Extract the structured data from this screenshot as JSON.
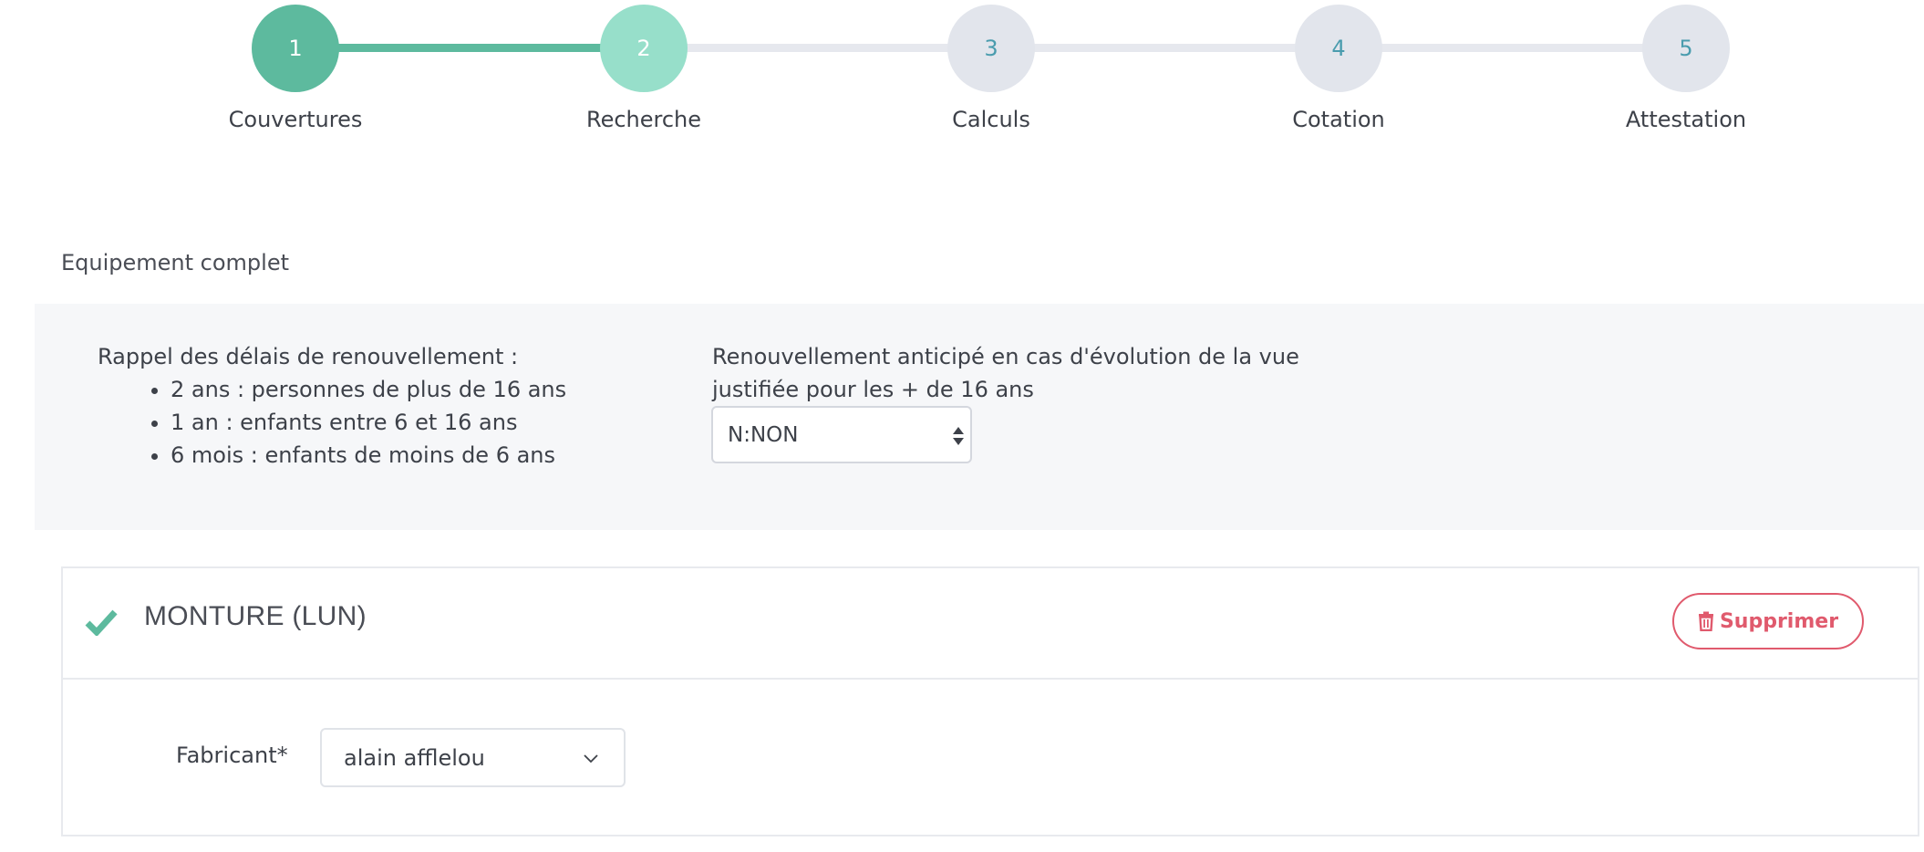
{
  "stepper": {
    "steps": [
      {
        "number": "1",
        "label": "Couvertures",
        "state": "done"
      },
      {
        "number": "2",
        "label": "Recherche",
        "state": "current"
      },
      {
        "number": "3",
        "label": "Calculs",
        "state": "pending"
      },
      {
        "number": "4",
        "label": "Cotation",
        "state": "pending"
      },
      {
        "number": "5",
        "label": "Attestation",
        "state": "pending"
      }
    ]
  },
  "section": {
    "title": "Equipement complet"
  },
  "info": {
    "reminder_title": "Rappel des délais de renouvellement :",
    "reminder_items": [
      "2 ans : personnes de plus de 16 ans",
      "1 an : enfants entre 6 et 16 ans",
      "6 mois : enfants de moins de 6 ans"
    ],
    "renewal_label": "Renouvellement anticipé en cas d'évolution de la vue justifiée pour les + de 16 ans",
    "renewal_value": "N:NON"
  },
  "card": {
    "title": "MONTURE (LUN)",
    "delete_label": "Supprimer",
    "fabricant_label": "Fabricant*",
    "fabricant_value": "alain afflelou"
  },
  "colors": {
    "accent": "#5dba9e",
    "accent_light": "#97dfca",
    "pending": "#e2e5ec",
    "danger": "#e05a6d"
  }
}
